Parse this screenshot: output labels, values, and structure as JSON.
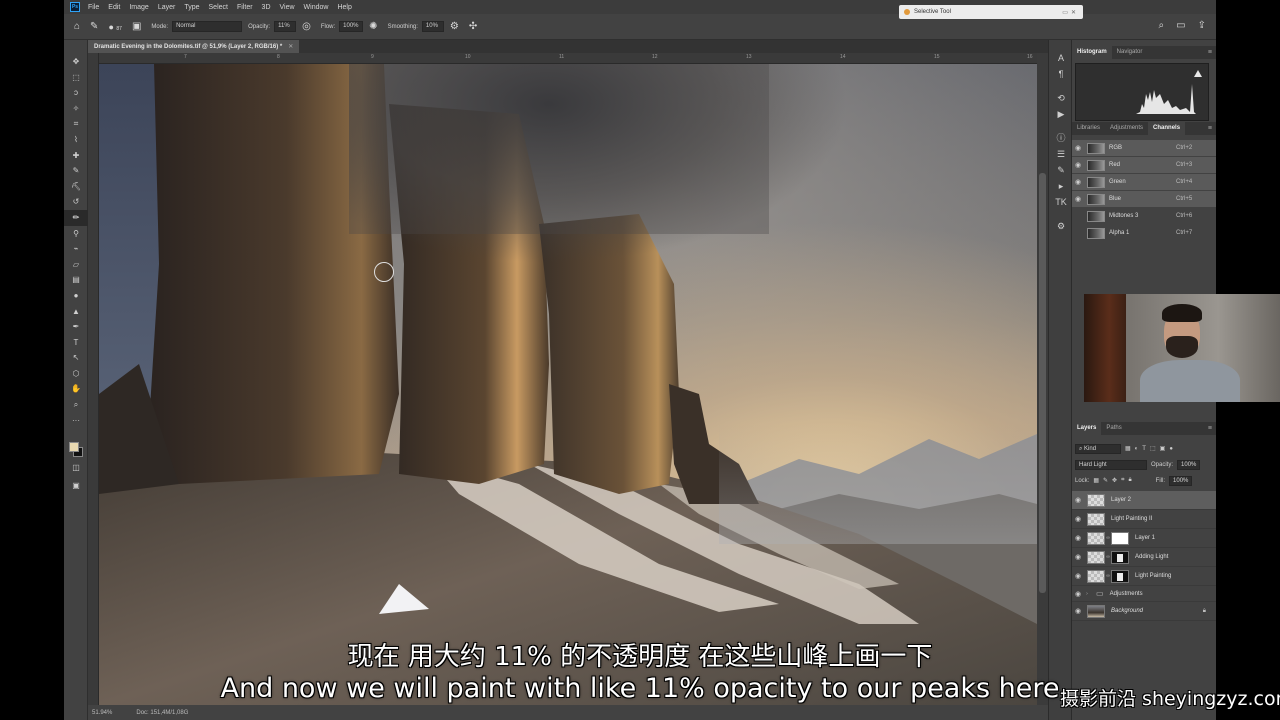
{
  "menu": {
    "items": [
      "File",
      "Edit",
      "Image",
      "Layer",
      "Type",
      "Select",
      "Filter",
      "3D",
      "View",
      "Window",
      "Help"
    ]
  },
  "selective_tool": {
    "title": "Selective Tool"
  },
  "options": {
    "brush_size": "87",
    "mode_label": "Mode:",
    "mode_value": "Normal",
    "opacity_label": "Opacity:",
    "opacity_value": "11%",
    "flow_label": "Flow:",
    "flow_value": "100%",
    "smoothing_label": "Smoothing:",
    "smoothing_value": "10%"
  },
  "document": {
    "tab_title": "Dramatic Evening in the Dolomites.tif @ 51,9% (Layer 2, RGB/16) *",
    "zoom": "51.94%",
    "doc_size": "Doc: 151,4M/1,08G"
  },
  "ruler": {
    "ticks": [
      "7",
      "8",
      "9",
      "10",
      "11",
      "12",
      "13",
      "14",
      "15",
      "16"
    ]
  },
  "panels": {
    "histogram_tabs": [
      "Histogram",
      "Navigator"
    ],
    "channel_tabs": [
      "Libraries",
      "Adjustments",
      "Channels"
    ],
    "layer_tabs": [
      "Layers",
      "Paths"
    ]
  },
  "channels": [
    {
      "name": "RGB",
      "shortcut": "Ctrl+2",
      "visible": true,
      "selected": true
    },
    {
      "name": "Red",
      "shortcut": "Ctrl+3",
      "visible": true,
      "selected": true
    },
    {
      "name": "Green",
      "shortcut": "Ctrl+4",
      "visible": true,
      "selected": true
    },
    {
      "name": "Blue",
      "shortcut": "Ctrl+5",
      "visible": true,
      "selected": true
    },
    {
      "name": "Midtones 3",
      "shortcut": "Ctrl+6",
      "visible": false,
      "selected": false
    },
    {
      "name": "Alpha 1",
      "shortcut": "Ctrl+7",
      "visible": false,
      "selected": false
    }
  ],
  "layers_controls": {
    "kind": "Kind",
    "blend_mode": "Hard Light",
    "opacity_label": "Opacity:",
    "opacity_value": "100%",
    "lock_label": "Lock:",
    "fill_label": "Fill:",
    "fill_value": "100%"
  },
  "layers": [
    {
      "name": "Layer 2",
      "selected": true
    },
    {
      "name": "Light Painting II",
      "selected": false
    },
    {
      "name": "Layer 1",
      "selected": false
    },
    {
      "name": "Adding Light",
      "selected": false
    },
    {
      "name": "Light Painting",
      "selected": false
    },
    {
      "name": "Adjustments",
      "selected": false
    },
    {
      "name": "Background",
      "selected": false
    }
  ],
  "subtitles": {
    "zh": "现在 用大约 11% 的不透明度 在这些山峰上画一下",
    "en": "And now we will paint with like 11% opacity to our peaks here"
  },
  "watermark": "摄影前沿 sheyingzyz.com",
  "colors": {
    "foreground": "#e8d8b0",
    "background": "#111111",
    "panel_bg": "#424242",
    "workspace": "#535353"
  }
}
